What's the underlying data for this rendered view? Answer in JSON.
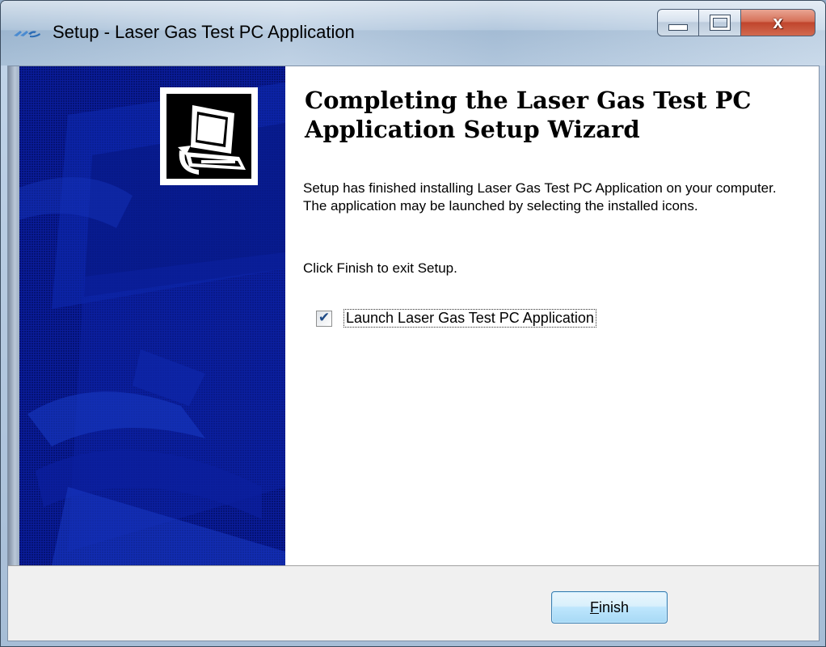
{
  "window": {
    "title": "Setup - Laser Gas Test PC Application",
    "app_icon": "hs-logo-icon",
    "caption_buttons": {
      "minimize": "minimize-icon",
      "maximize": "maximize-icon",
      "close_glyph": "x"
    }
  },
  "wizard": {
    "heading": "Completing the Laser Gas Test PC Application Setup Wizard",
    "body": "Setup has finished installing Laser Gas Test PC Application on your computer. The application may be launched by selecting the installed icons.",
    "finish_hint": "Click Finish to exit Setup.",
    "launch_checkbox": {
      "label": "Launch Laser Gas Test PC Application",
      "checked": true
    },
    "setup_icon": "computer-setup-icon"
  },
  "buttons": {
    "finish_mnemonic": "F",
    "finish_rest": "inish"
  },
  "colors": {
    "banner": "#00107a",
    "button_border": "#3c7fb1"
  }
}
